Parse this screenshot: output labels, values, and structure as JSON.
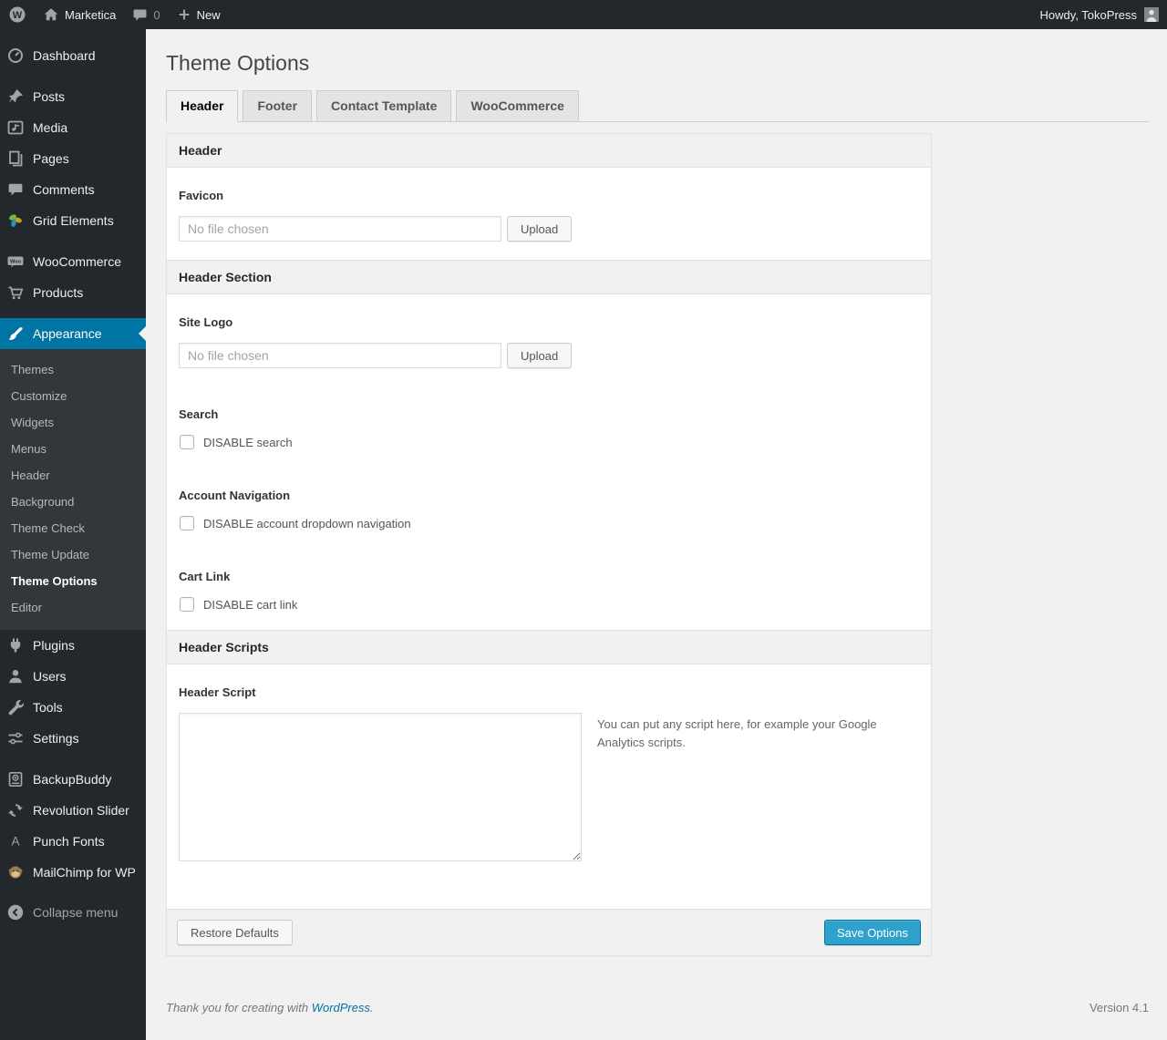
{
  "admin_bar": {
    "site_name": "Marketica",
    "comment_count": "0",
    "new_label": "New",
    "howdy": "Howdy, TokoPress"
  },
  "page": {
    "title": "Theme Options"
  },
  "tabs": [
    {
      "label": "Header",
      "active": true
    },
    {
      "label": "Footer",
      "active": false
    },
    {
      "label": "Contact Template",
      "active": false
    },
    {
      "label": "WooCommerce",
      "active": false
    }
  ],
  "sidebar": {
    "items": [
      {
        "label": "Dashboard"
      },
      {
        "label": "Posts"
      },
      {
        "label": "Media"
      },
      {
        "label": "Pages"
      },
      {
        "label": "Comments"
      },
      {
        "label": "Grid Elements"
      },
      {
        "label": "WooCommerce"
      },
      {
        "label": "Products"
      },
      {
        "label": "Appearance"
      },
      {
        "label": "Plugins"
      },
      {
        "label": "Users"
      },
      {
        "label": "Tools"
      },
      {
        "label": "Settings"
      },
      {
        "label": "BackupBuddy"
      },
      {
        "label": "Revolution Slider"
      },
      {
        "label": "Punch Fonts"
      },
      {
        "label": "MailChimp for WP"
      },
      {
        "label": "Collapse menu"
      }
    ],
    "submenu": [
      "Themes",
      "Customize",
      "Widgets",
      "Menus",
      "Header",
      "Background",
      "Theme Check",
      "Theme Update",
      "Theme Options",
      "Editor"
    ],
    "current_submenu": "Theme Options"
  },
  "panel": {
    "section_header": "Header",
    "section_header_section": "Header Section",
    "section_header_scripts": "Header Scripts",
    "favicon_label": "Favicon",
    "favicon_placeholder": "No file chosen",
    "favicon_upload": "Upload",
    "site_logo_label": "Site Logo",
    "site_logo_placeholder": "No file chosen",
    "site_logo_upload": "Upload",
    "search_label": "Search",
    "search_checkbox": "DISABLE search",
    "account_label": "Account Navigation",
    "account_checkbox": "DISABLE account dropdown navigation",
    "cart_label": "Cart Link",
    "cart_checkbox": "DISABLE cart link",
    "script_label": "Header Script",
    "script_hint": "You can put any script here, for example your Google Analytics scripts.",
    "restore_button": "Restore Defaults",
    "save_button": "Save Options"
  },
  "footer": {
    "thanks_prefix": "Thank you for creating with ",
    "wordpress_link": "WordPress",
    "thanks_suffix": ".",
    "version": "Version 4.1"
  },
  "colors": {
    "admin_dark": "#23282d",
    "submenu_dark": "#32373c",
    "active_blue": "#0074a2",
    "primary_button_blue": "#2ea2cc",
    "page_background": "#f1f1f1",
    "link_blue": "#0074a2"
  }
}
